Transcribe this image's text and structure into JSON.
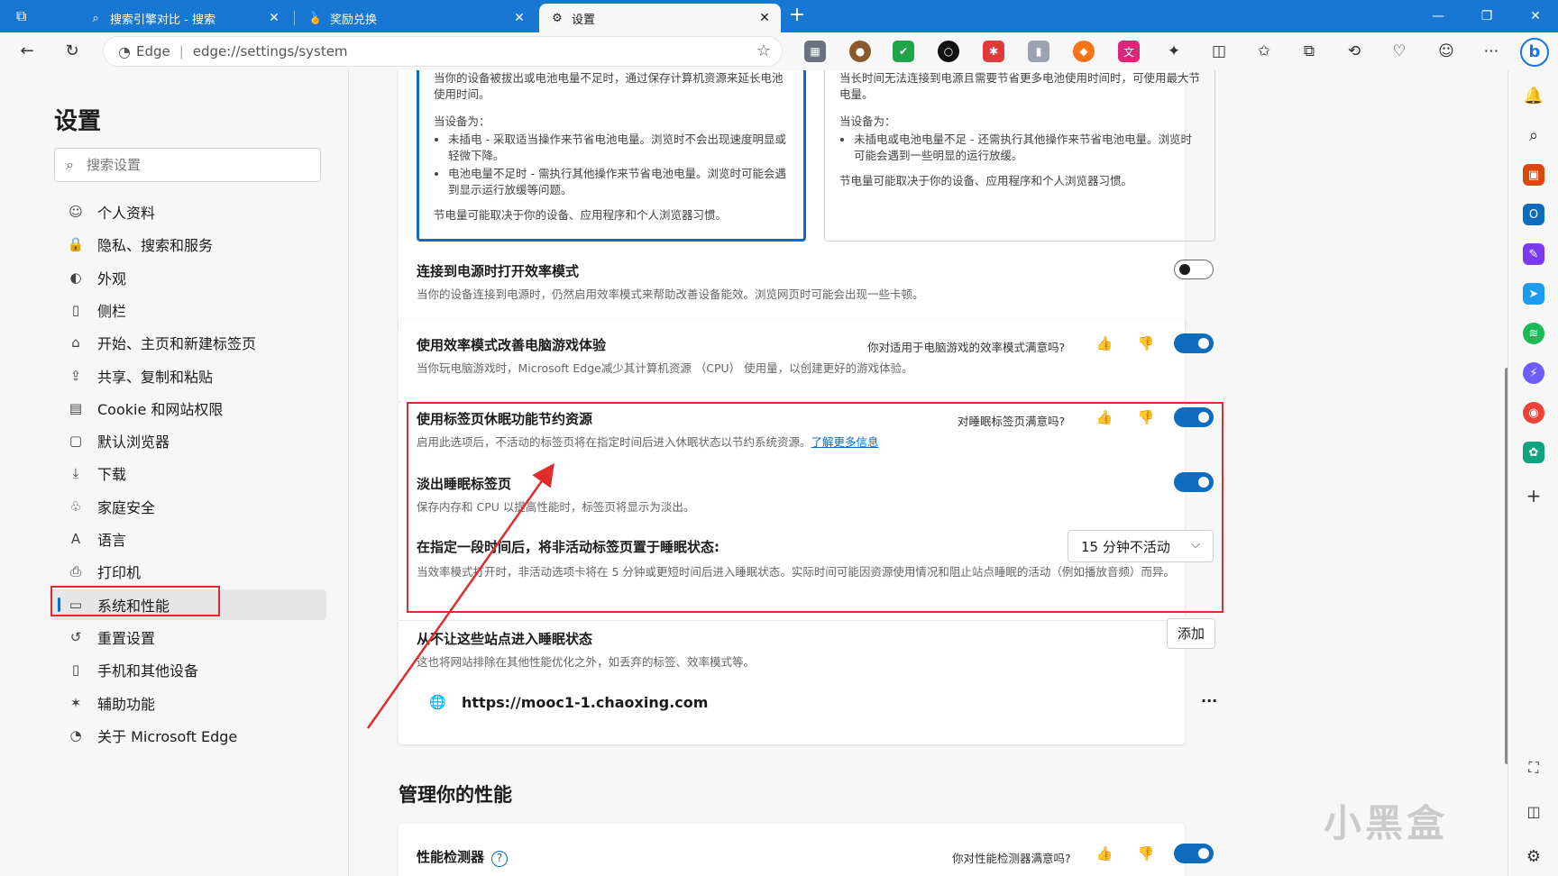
{
  "tabs": [
    {
      "title": "搜索引擎对比 - 搜索",
      "icon": "search-tab-icon"
    },
    {
      "title": "奖励兑换",
      "icon": "medal-icon"
    },
    {
      "title": "设置",
      "icon": "gear-icon"
    }
  ],
  "omnibox": {
    "brand": "Edge",
    "url": "edge://settings/system"
  },
  "sidebar": {
    "title": "设置",
    "search_placeholder": "搜索设置",
    "items": [
      {
        "label": "个人资料",
        "icon": "profile-icon"
      },
      {
        "label": "隐私、搜索和服务",
        "icon": "lock-icon"
      },
      {
        "label": "外观",
        "icon": "palette-icon"
      },
      {
        "label": "侧栏",
        "icon": "sidebar-icon"
      },
      {
        "label": "开始、主页和新建标签页",
        "icon": "home-icon"
      },
      {
        "label": "共享、复制和粘贴",
        "icon": "share-icon"
      },
      {
        "label": "Cookie 和网站权限",
        "icon": "cookie-icon"
      },
      {
        "label": "默认浏览器",
        "icon": "browser-icon"
      },
      {
        "label": "下载",
        "icon": "download-icon"
      },
      {
        "label": "家庭安全",
        "icon": "family-icon"
      },
      {
        "label": "语言",
        "icon": "language-icon"
      },
      {
        "label": "打印机",
        "icon": "printer-icon"
      },
      {
        "label": "系统和性能",
        "icon": "laptop-icon"
      },
      {
        "label": "重置设置",
        "icon": "reset-icon"
      },
      {
        "label": "手机和其他设备",
        "icon": "phone-icon"
      },
      {
        "label": "辅助功能",
        "icon": "accessibility-icon"
      },
      {
        "label": "关于 Microsoft Edge",
        "icon": "edge-logo-icon"
      }
    ],
    "selected_index": 12
  },
  "modes": {
    "left": {
      "intro": "当你的设备被拔出或电池电量不足时，通过保存计算机资源来延长电池使用时间。",
      "when": "当设备为：",
      "bullets": [
        "未插电 - 采取适当操作来节省电池电量。浏览时不会出现速度明显或轻微下降。",
        "电池电量不足时 - 需执行其他操作来节省电池电量。浏览时可能会遇到显示运行放缓等问题。"
      ],
      "note": "节电量可能取决于你的设备、应用程序和个人浏览器习惯。"
    },
    "right": {
      "intro": "当长时间无法连接到电源且需要节省更多电池使用时间时，可使用最大节电量。",
      "when": "当设备为：",
      "bullets": [
        "未插电或电池电量不足 - 还需执行其他操作来节省电池电量。浏览时可能会遇到一些明显的运行放缓。"
      ],
      "note": "节电量可能取决于你的设备、应用程序和个人浏览器习惯。"
    }
  },
  "rows": {
    "power_connected": {
      "title": "连接到电源时打开效率模式",
      "desc": "当你的设备连接到电源时，仍然启用效率模式来帮助改善设备能效。浏览网页时可能会出现一些卡顿。",
      "on": false
    },
    "gaming": {
      "title": "使用效率模式改善电脑游戏体验",
      "feedback": "你对适用于电脑游戏的效率模式满意吗?",
      "desc": "当你玩电脑游戏时，Microsoft Edge减少其计算机资源 （CPU） 使用量，以创建更好的游戏体验。",
      "on": true
    },
    "sleeping_tabs": {
      "title": "使用标签页休眠功能节约资源",
      "feedback": "对睡眠标签页满意吗?",
      "desc": "启用此选项后，不活动的标签页将在指定时间后进入休眠状态以节约系统资源。",
      "link": "了解更多信息",
      "on": true
    },
    "fade_tabs": {
      "title": "淡出睡眠标签页",
      "desc": "保存内存和 CPU 以提高性能时，标签页将显示为淡出。",
      "on": true
    },
    "sleep_after": {
      "title": "在指定一段时间后，将非活动标签页置于睡眠状态:",
      "dropdown": "15 分钟不活动",
      "desc": "当效率模式打开时，非活动选项卡将在 5 分钟或更短时间后进入睡眠状态。实际时间可能因资源使用情况和阻止站点睡眠的活动（例如播放音频）而异。"
    },
    "never_sleep": {
      "title": "从不让这些站点进入睡眠状态",
      "add_label": "添加",
      "desc": "这也将网站排除在其他性能优化之外，如丢弃的标签、效率模式等。",
      "site": "https://mooc1-1.chaoxing.com",
      "more": "···"
    }
  },
  "performance": {
    "section_title": "管理你的性能",
    "detector_title": "性能检测器",
    "help": "?",
    "feedback": "你对性能检测器满意吗?",
    "on": true
  },
  "window": {
    "minimize": "—",
    "restore": "❐",
    "close": "✕",
    "new_tab": "+"
  },
  "watermark": "小黑盒",
  "colors": {
    "accent": "#0f6cbd",
    "titlebar": "#1777d2",
    "annotation": "#e02c2c"
  }
}
